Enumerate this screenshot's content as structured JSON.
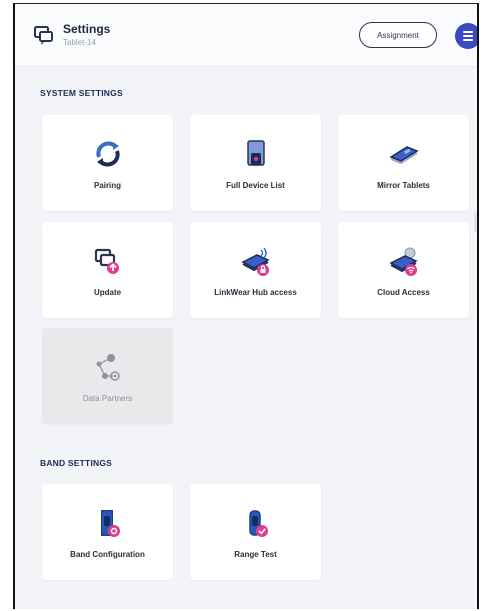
{
  "header": {
    "title": "Settings",
    "subtitle": "Tablet-14",
    "assignment_label": "Assignment",
    "menu_icon": "hamburger-menu-icon",
    "app_icon": "chat-bubbles-icon"
  },
  "system_settings": {
    "title": "SYSTEM SETTINGS",
    "items": [
      {
        "label": "Pairing",
        "icon": "sync-icon",
        "enabled": true
      },
      {
        "label": "Full Device List",
        "icon": "tablet-list-icon",
        "enabled": true
      },
      {
        "label": "Mirror Tablets",
        "icon": "mirror-tablets-icon",
        "enabled": true
      },
      {
        "label": "Update",
        "icon": "update-icon",
        "enabled": true
      },
      {
        "label": "LinkWear Hub access",
        "icon": "hub-lock-icon",
        "enabled": true
      },
      {
        "label": "Cloud Access",
        "icon": "cloud-wifi-icon",
        "enabled": true
      },
      {
        "label": "Data Partners",
        "icon": "data-partners-icon",
        "enabled": false
      }
    ]
  },
  "band_settings": {
    "title": "BAND SETTINGS",
    "items": [
      {
        "label": "Band Configuration",
        "icon": "band-gear-icon",
        "enabled": true
      },
      {
        "label": "Range Test",
        "icon": "band-check-icon",
        "enabled": true
      }
    ]
  },
  "colors": {
    "accent": "#3a4ac4",
    "navy": "#1e2a57",
    "magenta": "#e23c8c",
    "background": "#f3f4f8"
  }
}
